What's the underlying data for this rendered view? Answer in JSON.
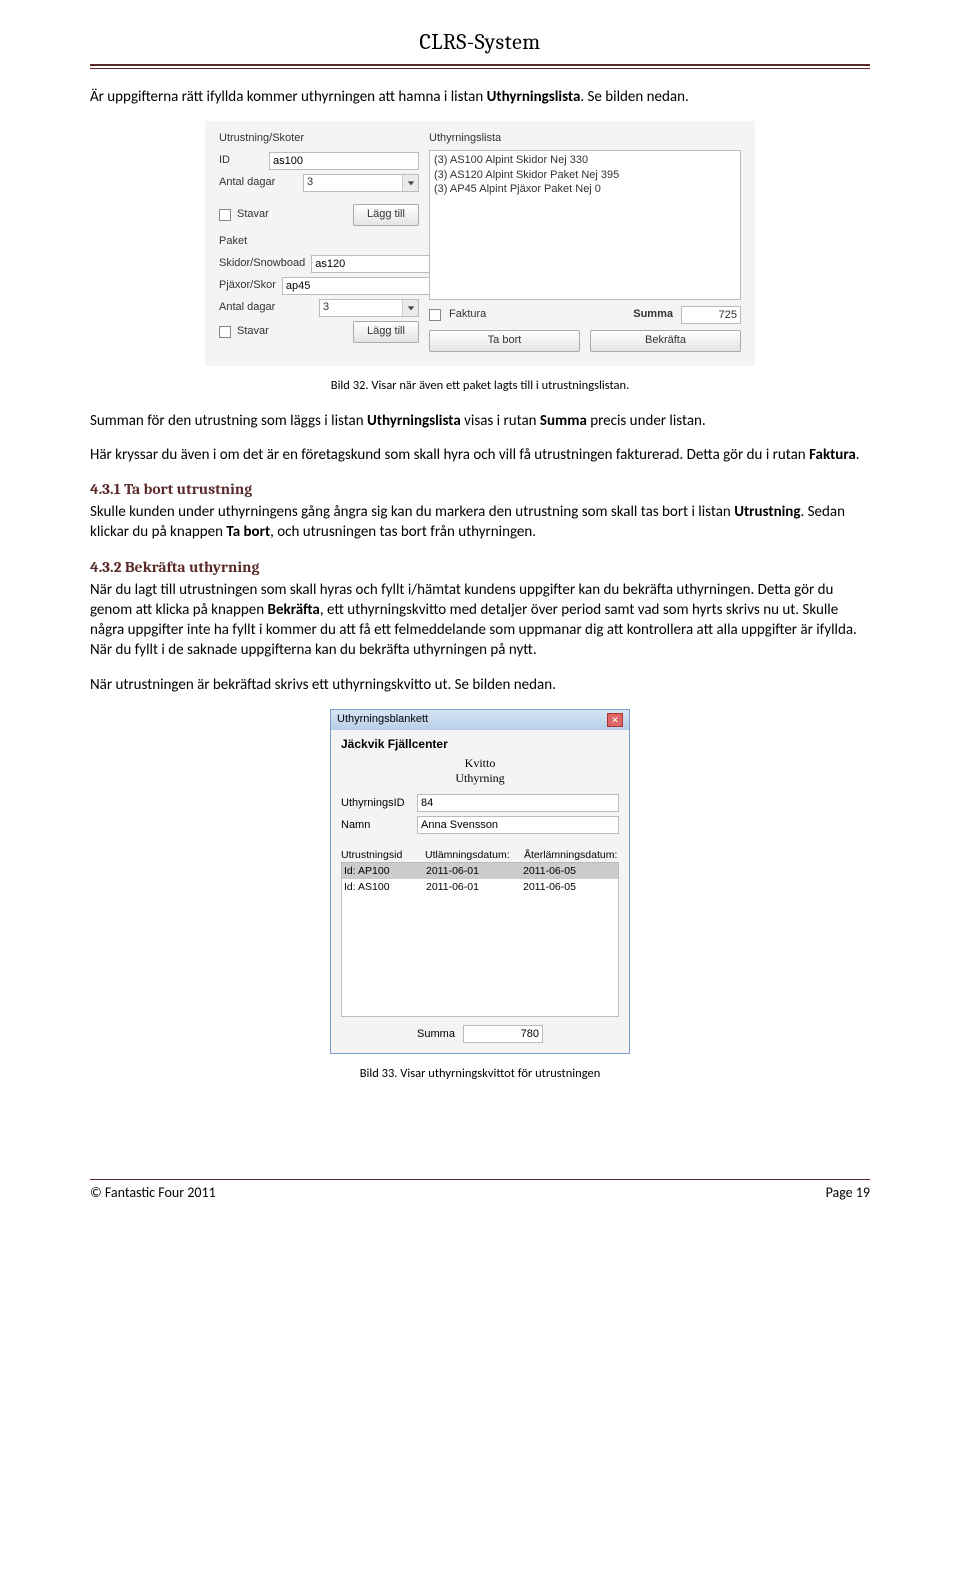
{
  "header": "CLRS-System",
  "p1": {
    "pre": "Är uppgifterna rätt ifyllda kommer uthyrningen att hamna i listan ",
    "b1": "Uthyrningslista",
    "post": ". Se bilden nedan."
  },
  "panel1": {
    "group1": "Utrustning/Skoter",
    "id_label": "ID",
    "id_value": "as100",
    "days_label": "Antal dagar",
    "days_value": "3",
    "stavar_label": "Stavar",
    "add_btn": "Lägg till",
    "group2": "Paket",
    "ski_label": "Skidor/Snowboad",
    "ski_value": "as120",
    "pj_label": "Pjäxor/Skor",
    "pj_value": "ap45",
    "days2_label": "Antal dagar",
    "days2_value": "3",
    "list_title": "Uthyrningslista",
    "list_items": [
      "(3) AS100  Alpint Skidor Nej 330",
      "(3) AS120  Alpint Skidor Paket Nej 395",
      "(3) AP45   Alpint Pjäxor Paket Nej 0"
    ],
    "faktura_label": "Faktura",
    "summa_label": "Summa",
    "summa_value": "725",
    "tabort_btn": "Ta bort",
    "bekrafta_btn": "Bekräfta"
  },
  "caption1": "Bild 32. Visar när även ett paket lagts till i utrustningslistan.",
  "p2": {
    "pre": "Summan för den utrustning som läggs i listan ",
    "b1": "Uthyrningslista",
    "mid": " visas i rutan ",
    "b2": "Summa",
    "post": " precis under listan."
  },
  "p3": {
    "pre": "Här kryssar du även i om det är en företagskund som skall hyra och vill få utrustningen fakturerad. Detta gör du i rutan ",
    "b1": "Faktura",
    "post": "."
  },
  "h1": "4.3.1 Ta bort utrustning",
  "p4": {
    "pre": "Skulle kunden under uthyrningens gång ångra sig kan du markera den utrustning som skall tas bort i listan ",
    "b1": "Utrustning",
    "mid": ". Sedan klickar du på knappen ",
    "b2": "Ta bort",
    "post": ", och utrusningen tas bort från uthyrningen."
  },
  "h2": "4.3.2 Bekräfta uthyrning",
  "p5": {
    "pre": "När du lagt till utrustningen som skall hyras och fyllt i/hämtat kundens uppgifter kan du bekräfta uthyrningen. Detta gör du genom att klicka på knappen ",
    "b1": "Bekräfta",
    "post": ", ett uthyrningskvitto med detaljer över period samt vad som hyrts skrivs nu ut. Skulle några uppgifter inte ha fyllt i kommer du att få ett felmeddelande som uppmanar dig att kontrollera att alla uppgifter är ifyllda. När du fyllt i de saknade uppgifterna kan du bekräfta uthyrningen på nytt."
  },
  "p6": "När utrustningen är bekräftad skrivs ett uthyrningskvitto ut. Se bilden nedan.",
  "dialog": {
    "title": "Uthyrningsblankett",
    "org": "Jäckvik Fjällcenter",
    "kvitto": "Kvitto",
    "uthyrning": "Uthyrning",
    "id_label": "UthyrningsID",
    "id_value": "84",
    "name_label": "Namn",
    "name_value": "Anna Svensson",
    "col1": "Utrustningsid",
    "col2": "Utlämningsdatum:",
    "col3": "Återlämningsdatum:",
    "rows": [
      {
        "c1": "Id: AP100",
        "c2": "2011-06-01",
        "c3": "2011-06-05"
      },
      {
        "c1": "Id: AS100",
        "c2": "2011-06-01",
        "c3": "2011-06-05"
      }
    ],
    "summa_label": "Summa",
    "summa_value": "780"
  },
  "caption2": "Bild 33. Visar uthyrningskvittot för utrustningen",
  "footer_left": "© Fantastic Four 2011",
  "footer_right": "Page 19"
}
